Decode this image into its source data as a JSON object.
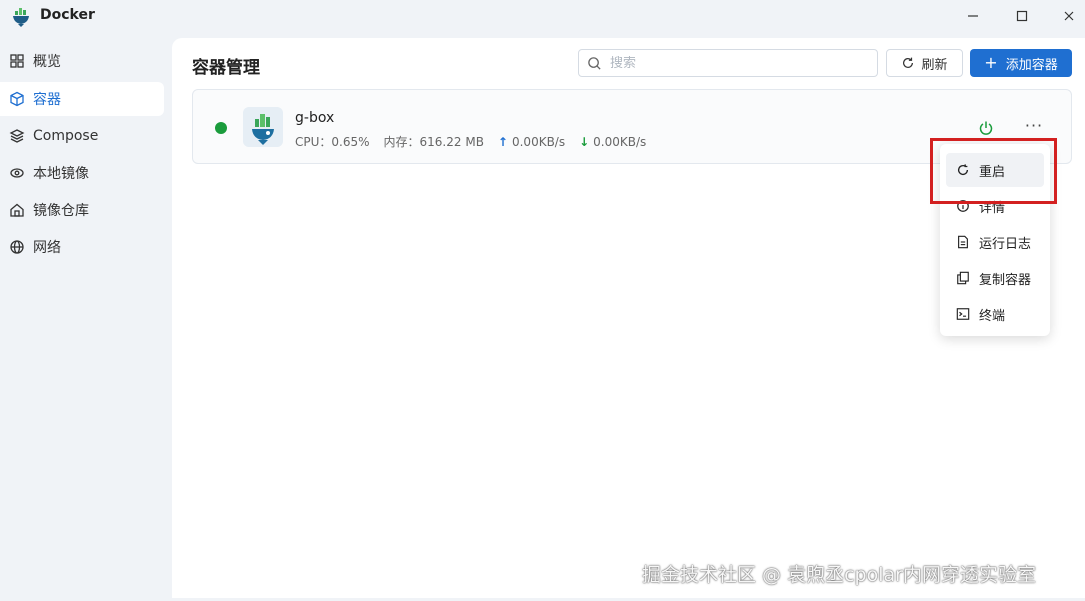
{
  "window": {
    "title": "Docker",
    "logo_icon": "docker-app-icon",
    "controls": [
      "minimize-icon",
      "maximize-icon",
      "close-icon"
    ]
  },
  "sidebar": {
    "items": [
      {
        "label": "概览",
        "icon": "grid-icon"
      },
      {
        "label": "容器",
        "icon": "cube-icon",
        "active": true
      },
      {
        "label": "Compose",
        "icon": "layers-icon"
      },
      {
        "label": "本地镜像",
        "icon": "eye-icon"
      },
      {
        "label": "镜像仓库",
        "icon": "home-icon"
      },
      {
        "label": "网络",
        "icon": "globe-icon"
      }
    ]
  },
  "header": {
    "title": "容器管理",
    "search_placeholder": "搜索",
    "refresh_label": "刷新",
    "add_label": "添加容器"
  },
  "containers": [
    {
      "name": "g-box",
      "status": "running",
      "cpu": "CPU：0.65%",
      "memory": "内存：616.22 MB",
      "upload": "0.00KB/s",
      "download": "0.00KB/s"
    }
  ],
  "menu": {
    "items": [
      {
        "label": "重启",
        "icon": "restart-icon"
      },
      {
        "label": "详情",
        "icon": "info-icon"
      },
      {
        "label": "运行日志",
        "icon": "log-file-icon"
      },
      {
        "label": "复制容器",
        "icon": "copy-icon"
      },
      {
        "label": "终端",
        "icon": "terminal-icon"
      }
    ]
  },
  "watermark": "掘金技术社区 @ 袁煦丞cpolar内网穿透实验室",
  "colors": {
    "accent": "#1f6fd1",
    "running": "#1a9c3c",
    "highlight": "#d32020"
  }
}
